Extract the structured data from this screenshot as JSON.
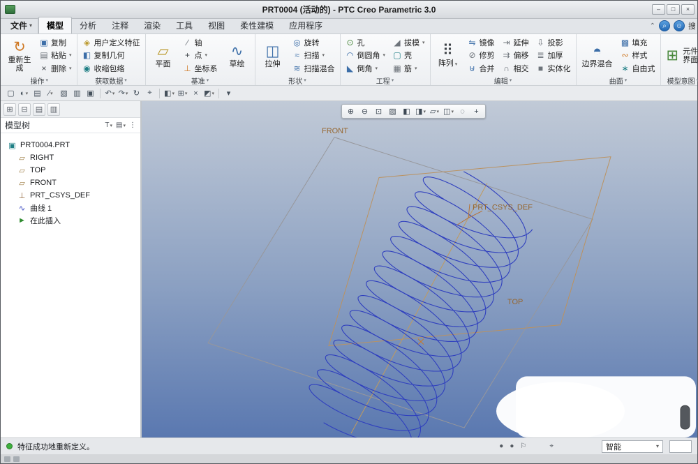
{
  "window": {
    "title": "PRT0004 (活动的) - PTC Creo Parametric 3.0",
    "minimize": "–",
    "restore": "□",
    "close": "×"
  },
  "tabs": {
    "file": "文件",
    "items": [
      "模型",
      "分析",
      "注释",
      "渲染",
      "工具",
      "视图",
      "柔性建模",
      "应用程序"
    ],
    "active": "模型",
    "collapse": "⌃",
    "search_glyph": "⌕",
    "account_glyph": "☺",
    "clipped": "搜"
  },
  "ribbon": {
    "g0": {
      "label": "操作",
      "big": "重新生成",
      "b1": "复制",
      "b2": "粘贴",
      "b3": "删除"
    },
    "g1": {
      "label": "获取数据",
      "b1": "用户定义特征",
      "b2": "复制几何",
      "b3": "收缩包络"
    },
    "g2": {
      "label": "基准",
      "big1": "平面",
      "b1": "轴",
      "b2": "点",
      "b3": "坐标系",
      "big2": "草绘"
    },
    "g3": {
      "label": "形状",
      "big": "拉伸",
      "b1": "旋转",
      "b2": "扫描",
      "b3": "扫描混合"
    },
    "g4": {
      "label": "工程",
      "c1": [
        "孔",
        "倒圆角",
        "倒角"
      ],
      "c2": [
        "拔模",
        "壳",
        "筋"
      ]
    },
    "g5": {
      "label": "编辑",
      "big": "阵列",
      "c1": [
        "镜像",
        "修剪",
        "合并"
      ],
      "c2": [
        "延伸",
        "偏移",
        "相交"
      ],
      "c3": [
        "投影",
        "加厚",
        "实体化"
      ]
    },
    "g6": {
      "label": "曲面",
      "big": "边界混合",
      "b1": "填充",
      "b2": "样式",
      "b3": "自由式"
    },
    "g7": {
      "label": "模型意图",
      "big": "元件界面"
    }
  },
  "icons": {
    "regenerate": "↻",
    "copy": "▣",
    "paste": "▤",
    "delete": "×",
    "udf": "◈",
    "copy_geometry": "◧",
    "shrinkwrap": "◉",
    "plane": "▱",
    "axis": "∕",
    "point": "+",
    "csys": "⊥",
    "sketch": "∿",
    "extrude": "◫",
    "revolve": "◎",
    "sweep": "≈",
    "swept_blend": "≋",
    "hole": "⊙",
    "round": "◠",
    "chamfer": "◣",
    "draft": "◢",
    "shell": "▢",
    "rib": "▦",
    "pattern": "⠿",
    "mirror": "⇋",
    "trim": "⊘",
    "merge": "⊎",
    "extend": "⇥",
    "offset": "⇉",
    "intersect": "∩",
    "project": "⇩",
    "thicken": "≣",
    "solidify": "■",
    "boundary_blend": "◓",
    "fill": "▩",
    "style": "∾",
    "freestyle": "∗",
    "component_interface": "⊞"
  },
  "quickbar": {
    "items": [
      {
        "n": "new-file",
        "g": "▢"
      },
      {
        "n": "model-display",
        "g": "◐"
      },
      {
        "n": "open",
        "g": "▤"
      },
      {
        "n": "edit",
        "g": "∕"
      },
      {
        "n": "mail",
        "g": "▧"
      },
      {
        "n": "print",
        "g": "▥"
      },
      {
        "n": "save",
        "g": "▣"
      },
      {
        "n": "undo",
        "g": "↶"
      },
      {
        "n": "redo",
        "g": "↷"
      },
      {
        "n": "regenerate",
        "g": "↻"
      },
      {
        "n": "find",
        "g": "⌖"
      },
      {
        "n": "display-style",
        "g": "◧"
      },
      {
        "n": "windows",
        "g": "⊞"
      },
      {
        "n": "close-window",
        "g": "×"
      },
      {
        "n": "options",
        "g": "◩"
      }
    ],
    "more": "▾"
  },
  "vp_toolbar": {
    "items": [
      {
        "n": "zoom-in",
        "g": "⊕"
      },
      {
        "n": "zoom-out",
        "g": "⊖"
      },
      {
        "n": "refit",
        "g": "⊡"
      },
      {
        "n": "repaint",
        "g": "▨"
      },
      {
        "n": "shading",
        "g": "◧"
      },
      {
        "n": "display-style",
        "g": "◨"
      },
      {
        "n": "datum-display",
        "g": "▱"
      },
      {
        "n": "saved-views",
        "g": "◫"
      },
      {
        "n": "annotations",
        "g": "◌"
      },
      {
        "n": "spin-center",
        "g": "+"
      }
    ]
  },
  "tree": {
    "header": "模型树",
    "filter_glyph": "T",
    "columns_glyph": "▤",
    "dots_glyph": "⋮",
    "toolbar": [
      {
        "n": "panel-grid",
        "g": "⊞"
      },
      {
        "n": "panel-pin",
        "g": "⊟"
      },
      {
        "n": "folder-browser",
        "g": "▤"
      },
      {
        "n": "favorites",
        "g": "▥"
      }
    ],
    "items": [
      {
        "label": "PRT0004.PRT",
        "icon": "▣"
      },
      {
        "label": "RIGHT",
        "icon": "▱"
      },
      {
        "label": "TOP",
        "icon": "▱"
      },
      {
        "label": "FRONT",
        "icon": "▱"
      },
      {
        "label": "PRT_CSYS_DEF",
        "icon": "⊥"
      },
      {
        "label": "曲线 1",
        "icon": "∿"
      },
      {
        "label": "在此插入",
        "icon": "►"
      }
    ]
  },
  "viewport": {
    "front": "FRONT",
    "top": "TOP",
    "csys": "PRT_CSYS_DEF"
  },
  "status": {
    "message": "特征成功地重新定义。",
    "smart": "智能",
    "dot1": "●",
    "dot2": "●",
    "flag": "⚐",
    "find": "⌖"
  }
}
